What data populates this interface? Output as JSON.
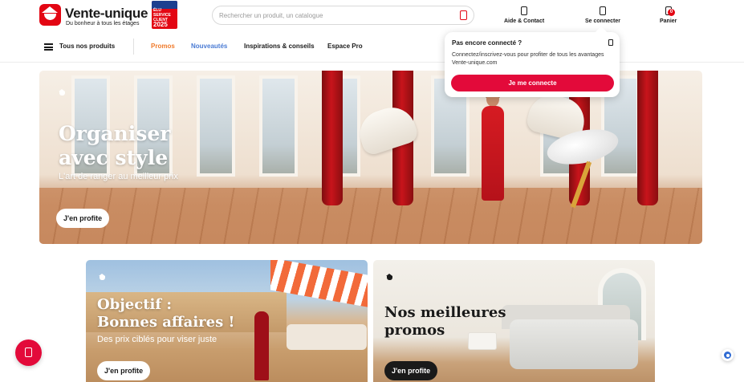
{
  "header": {
    "logo_name": "Vente-unique",
    "logo_tagline": "Du bonheur à tous les étages",
    "award_text": "ÉLU SERVICE CLIENT",
    "award_year": "2025",
    "search": {
      "placeholder": "Rechercher un produit, un catalogue"
    },
    "help_label": "Aide & Contact",
    "login_label": "Se connecter",
    "cart_label": "Panier",
    "cart_count": "0"
  },
  "nav": {
    "menu_label": "Tous nos produits",
    "links": [
      {
        "label": "Promos",
        "color": "#f07a2a"
      },
      {
        "label": "Nouveautés",
        "color": "#4a7bd4"
      },
      {
        "label": "Inspirations & conseils",
        "color": "#1a1a1a"
      },
      {
        "label": "Espace Pro",
        "color": "#1a1a1a"
      }
    ]
  },
  "hero": {
    "title_line1": "Organiser",
    "title_line2": "avec style",
    "subtitle": "L'art de ranger au meilleur prix",
    "cta": "J'en profite"
  },
  "cards": [
    {
      "title_line1": "Objectif :",
      "title_line2": "Bonnes affaires !",
      "subtitle": "Des prix ciblés pour viser juste",
      "cta": "J'en profite"
    },
    {
      "title_line1": "Nos meilleures",
      "title_line2": "promos",
      "cta": "J'en profite"
    }
  ],
  "popup": {
    "title": "Pas encore connecté ?",
    "text": "Connectez/inscrivez-vous pour profiter de tous les avantages Vente-unique.com",
    "button": "Je me connecte"
  },
  "colors": {
    "brand_red": "#e30613",
    "cta_red": "#e30a3a",
    "promo_orange": "#f07a2a",
    "new_blue": "#4a7bd4"
  },
  "icons": [
    "logo-icon",
    "search-icon",
    "help-icon",
    "user-icon",
    "cart-icon",
    "menu-icon",
    "close-icon",
    "chat-icon",
    "widget-icon",
    "brand-badge-icon"
  ]
}
